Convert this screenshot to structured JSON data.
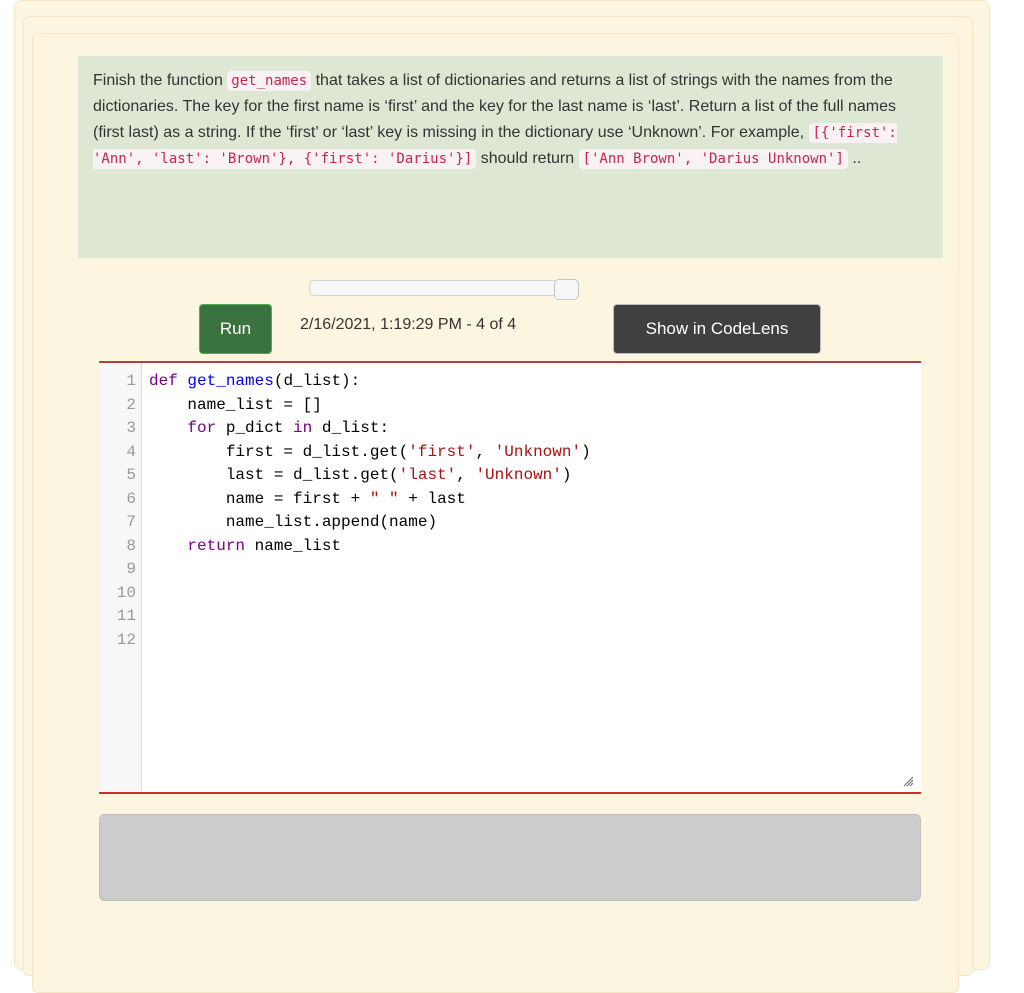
{
  "prompt": {
    "segments": [
      {
        "type": "text",
        "value": "Finish the function "
      },
      {
        "type": "code",
        "value": "get_names"
      },
      {
        "type": "text",
        "value": " that takes a list of dictionaries and returns a list of strings with the names from the dictionaries. The key for the first name is ‘first’ and the key for the last name is ‘last’. Return a list of the full names (first last) as a string. If the ‘first’ or ‘last’ key is missing in the dictionary use ‘Unknown’. For example, "
      },
      {
        "type": "code",
        "value": "[{'first': 'Ann', 'last': 'Brown'}, {'first': 'Darius'}]"
      },
      {
        "type": "text",
        "value": " should return "
      },
      {
        "type": "code",
        "value": "['Ann Brown', 'Darius Unknown']"
      },
      {
        "type": "text",
        "value": " .."
      }
    ]
  },
  "history_slider": {
    "position": 4,
    "total": 4
  },
  "toolbar": {
    "run_label": "Run",
    "timestamp": "2/16/2021, 1:19:29 PM - 4 of 4",
    "codelens_label": "Show in CodeLens"
  },
  "editor": {
    "lines": [
      [
        {
          "t": "kw",
          "v": "def"
        },
        {
          "t": "",
          "v": " "
        },
        {
          "t": "def",
          "v": "get_names"
        },
        {
          "t": "",
          "v": "(d_list):"
        }
      ],
      [
        {
          "t": "",
          "v": "    name_list = []"
        }
      ],
      [
        {
          "t": "",
          "v": "    "
        },
        {
          "t": "kw",
          "v": "for"
        },
        {
          "t": "",
          "v": " p_dict "
        },
        {
          "t": "kw",
          "v": "in"
        },
        {
          "t": "",
          "v": " d_list:"
        }
      ],
      [
        {
          "t": "",
          "v": "        first = d_list.get("
        },
        {
          "t": "str",
          "v": "'first'"
        },
        {
          "t": "",
          "v": ", "
        },
        {
          "t": "str",
          "v": "'Unknown'"
        },
        {
          "t": "",
          "v": ")"
        }
      ],
      [
        {
          "t": "",
          "v": "        last = d_list.get("
        },
        {
          "t": "str",
          "v": "'last'"
        },
        {
          "t": "",
          "v": ", "
        },
        {
          "t": "str",
          "v": "'Unknown'"
        },
        {
          "t": "",
          "v": ")"
        }
      ],
      [
        {
          "t": "",
          "v": "        name = first + "
        },
        {
          "t": "str",
          "v": "\" \""
        },
        {
          "t": "",
          "v": " + last"
        }
      ],
      [
        {
          "t": "",
          "v": "        name_list.append(name)"
        }
      ],
      [
        {
          "t": "",
          "v": "    "
        },
        {
          "t": "kw",
          "v": "return"
        },
        {
          "t": "",
          "v": " name_list"
        }
      ],
      [],
      [],
      [],
      []
    ]
  },
  "output": {
    "text": ""
  }
}
